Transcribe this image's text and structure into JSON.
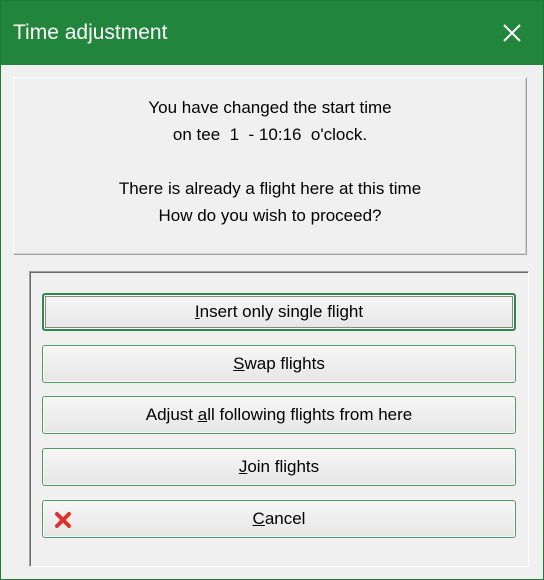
{
  "window": {
    "title": "Time adjustment",
    "close_icon": "close-x-icon",
    "title_bar_color": "#21863b"
  },
  "message": {
    "line1": "You have changed the start time",
    "line2": "on tee  1  - 10:16  o'clock.",
    "line3": "There is already a flight here at this time",
    "line4": "How do you wish to proceed?"
  },
  "options": [
    {
      "label": "Insert only single flight",
      "mnemonic": "I",
      "focused": true
    },
    {
      "label": "Swap flights",
      "mnemonic": "S"
    },
    {
      "label": "Adjust all following flights from here",
      "mnemonic": "a"
    },
    {
      "label": "Join flights",
      "mnemonic": "J"
    },
    {
      "label": "Cancel",
      "mnemonic": "C",
      "icon": "red-x-cancel-icon",
      "icon_color": "#e0302a"
    }
  ]
}
